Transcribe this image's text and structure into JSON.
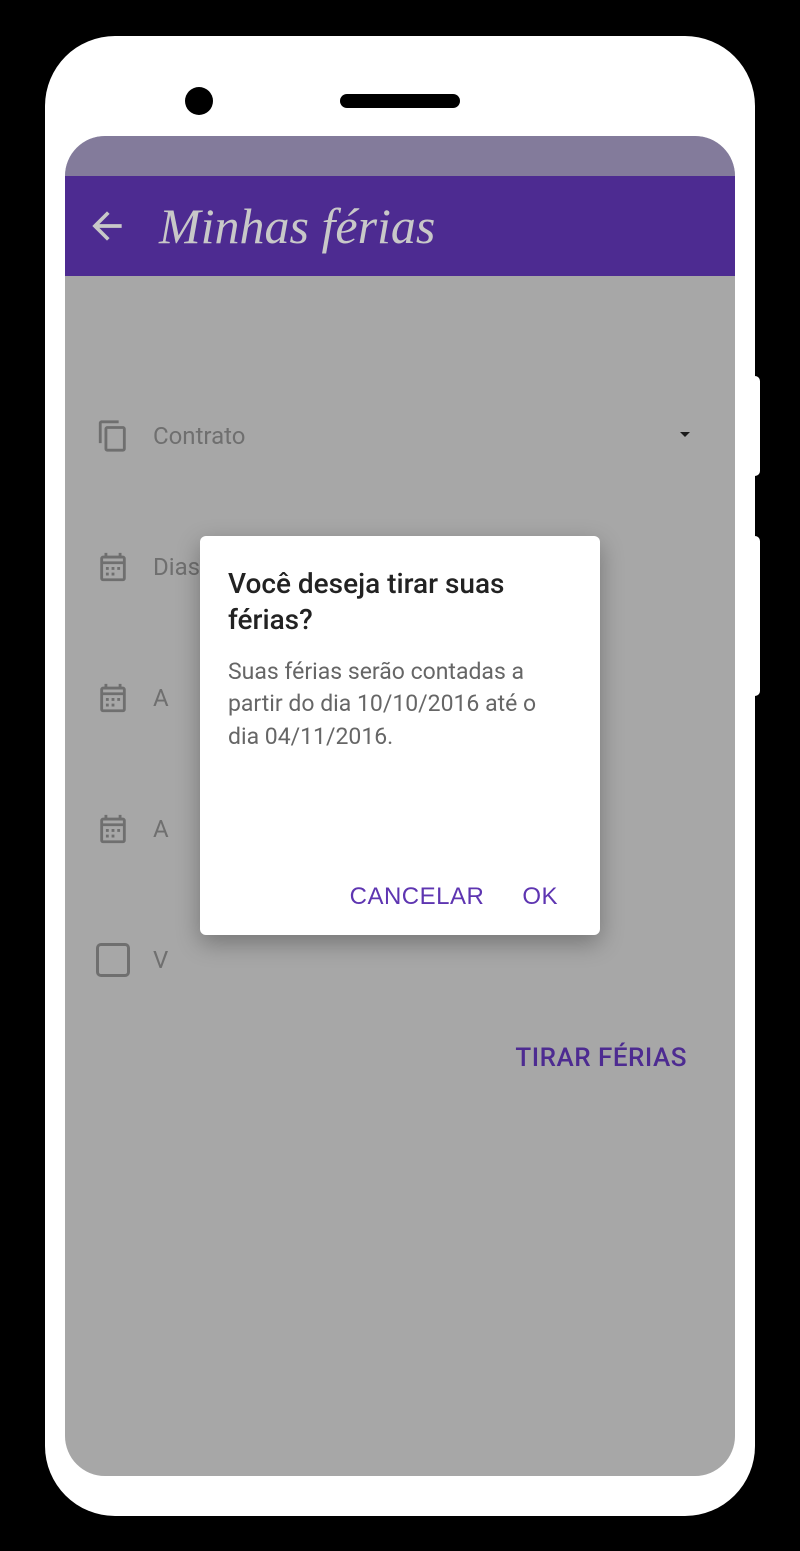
{
  "header": {
    "title": "Minhas férias"
  },
  "form": {
    "contract": {
      "label": "Contrato"
    },
    "vacation_days": {
      "label": "Dias de férias"
    },
    "row3": {
      "label": "A"
    },
    "row4": {
      "label": "A"
    },
    "checkbox_label": "V"
  },
  "action": {
    "tirar_ferias": "TIRAR FÉRIAS"
  },
  "dialog": {
    "title": "Você deseja tirar suas férias?",
    "body": "Suas férias serão contadas a partir do dia 10/10/2016 até o dia 04/11/2016.",
    "cancel": "CANCELAR",
    "ok": "OK"
  },
  "colors": {
    "primary": "#5e35b1",
    "statusbar": "#a096be"
  }
}
